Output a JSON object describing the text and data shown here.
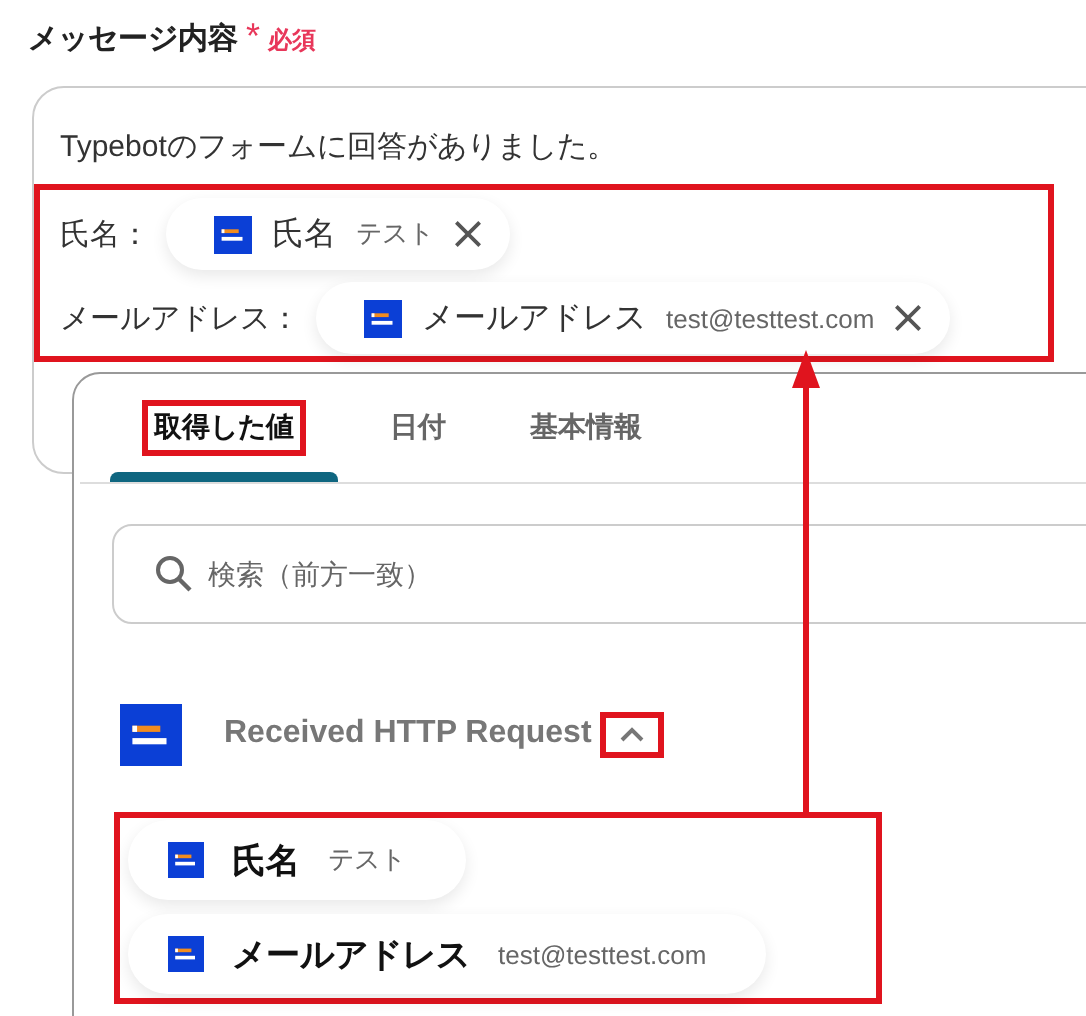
{
  "field": {
    "label": "メッセージ内容",
    "required_mark": "*",
    "required_label": "必須",
    "intro": "Typebotのフォームに回答がありました。",
    "rows_highlighted": true,
    "rows": [
      {
        "label": "氏名：",
        "chip": {
          "name": "氏名",
          "value": "テスト"
        }
      },
      {
        "label": "メールアドレス：",
        "chip": {
          "name": "メールアドレス",
          "value": "test@testtest.com"
        }
      }
    ]
  },
  "picker": {
    "tabs": [
      {
        "label": "取得した値",
        "selected": true,
        "highlighted": true
      },
      {
        "label": "日付",
        "selected": false,
        "highlighted": false
      },
      {
        "label": "基本情報",
        "selected": false,
        "highlighted": false
      }
    ],
    "search": {
      "placeholder": "検索（前方一致）"
    },
    "source": {
      "title": "Received HTTP Request",
      "expanded": true,
      "toggle_highlighted": true,
      "items_highlighted": true,
      "items": [
        {
          "name": "氏名",
          "value": "テスト"
        },
        {
          "name": "メールアドレス",
          "value": "test@testtest.com"
        }
      ]
    }
  },
  "annotation_arrow": true
}
